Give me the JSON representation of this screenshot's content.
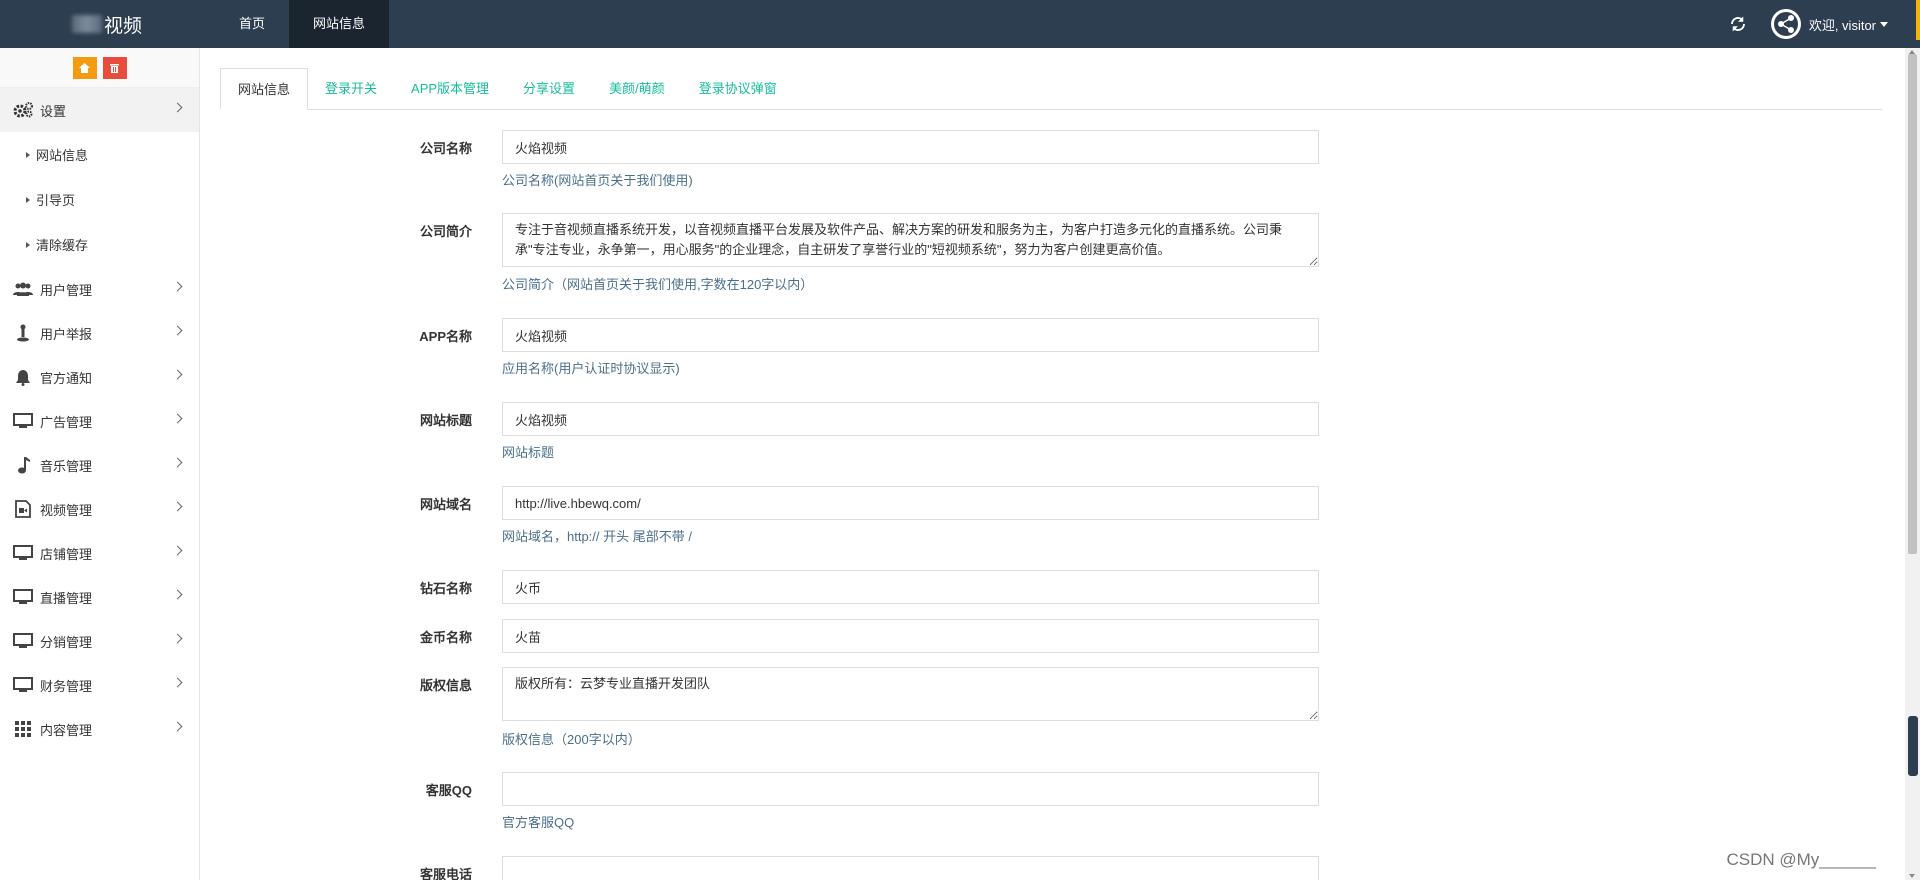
{
  "header": {
    "brand": "视频",
    "nav": [
      {
        "label": "首页",
        "active": false
      },
      {
        "label": "网站信息",
        "active": true
      }
    ],
    "user_greeting": "欢迎, visitor"
  },
  "sidebar": {
    "shortcuts": [
      "home-icon",
      "trash-icon"
    ],
    "settings_label": "设置",
    "sub_items": [
      "网站信息",
      "引导页",
      "清除缓存"
    ],
    "items": [
      {
        "label": "用户管理",
        "icon": "users-icon"
      },
      {
        "label": "用户举报",
        "icon": "report-icon"
      },
      {
        "label": "官方通知",
        "icon": "bell-icon"
      },
      {
        "label": "广告管理",
        "icon": "monitor-icon"
      },
      {
        "label": "音乐管理",
        "icon": "music-icon"
      },
      {
        "label": "视频管理",
        "icon": "video-file-icon"
      },
      {
        "label": "店铺管理",
        "icon": "monitor-icon"
      },
      {
        "label": "直播管理",
        "icon": "monitor-icon"
      },
      {
        "label": "分销管理",
        "icon": "monitor-icon"
      },
      {
        "label": "财务管理",
        "icon": "monitor-icon"
      },
      {
        "label": "内容管理",
        "icon": "grid-icon"
      }
    ]
  },
  "tabs": [
    "网站信息",
    "登录开关",
    "APP版本管理",
    "分享设置",
    "美颜/萌颜",
    "登录协议弹窗"
  ],
  "form": {
    "company_name": {
      "label": "公司名称",
      "value": "火焰视频",
      "help": "公司名称(网站首页关于我们使用)"
    },
    "company_intro": {
      "label": "公司简介",
      "value": "专注于音视频直播系统开发，以音视频直播平台发展及软件产品、解决方案的研发和服务为主，为客户打造多元化的直播系统。公司秉承\"专注专业，永争第一，用心服务\"的企业理念，自主研发了享誉行业的\"短视频系统\"，努力为客户创建更高价值。",
      "help": "公司简介（网站首页关于我们使用,字数在120字以内）"
    },
    "app_name": {
      "label": "APP名称",
      "value": "火焰视频",
      "help": "应用名称(用户认证时协议显示)"
    },
    "site_title": {
      "label": "网站标题",
      "value": "火焰视频",
      "help": "网站标题"
    },
    "site_domain": {
      "label": "网站域名",
      "value": "http://live.hbewq.com/",
      "help": "网站域名，http:// 开头 尾部不带 /"
    },
    "diamond_name": {
      "label": "钻石名称",
      "value": "火币"
    },
    "coin_name": {
      "label": "金币名称",
      "value": "火苗"
    },
    "copyright": {
      "label": "版权信息",
      "value": "版权所有：云梦专业直播开发团队",
      "help": "版权信息（200字以内）"
    },
    "service_qq": {
      "label": "客服QQ",
      "value": "",
      "help": "官方客服QQ"
    },
    "service_phone": {
      "label": "客服电话",
      "value": ""
    }
  },
  "watermark": "CSDN @My______"
}
